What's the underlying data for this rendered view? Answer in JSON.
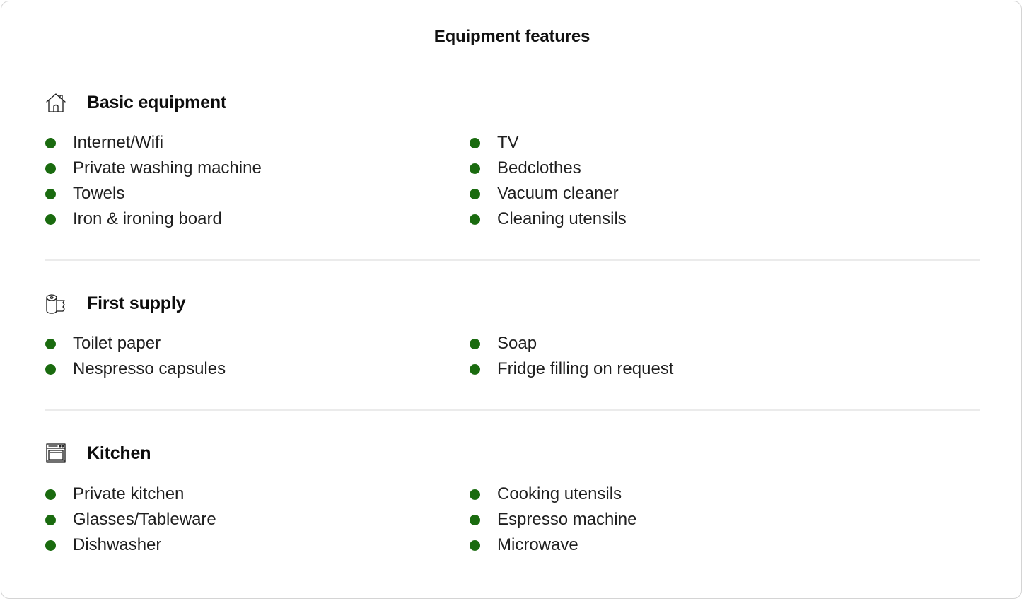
{
  "title": "Equipment features",
  "colors": {
    "bullet": "#1a6b0f",
    "divider": "#ebebeb",
    "border": "#d4d4d4"
  },
  "sections": [
    {
      "icon": "house-icon",
      "title": "Basic equipment",
      "left": [
        "Internet/Wifi",
        "Private washing machine",
        "Towels",
        "Iron & ironing board"
      ],
      "right": [
        "TV",
        "Bedclothes",
        "Vacuum cleaner",
        "Cleaning utensils"
      ]
    },
    {
      "icon": "toilet-paper-icon",
      "title": "First supply",
      "left": [
        "Toilet paper",
        "Nespresso capsules"
      ],
      "right": [
        "Soap",
        "Fridge filling on request"
      ]
    },
    {
      "icon": "oven-icon",
      "title": "Kitchen",
      "left": [
        "Private kitchen",
        "Glasses/Tableware",
        "Dishwasher"
      ],
      "right": [
        "Cooking utensils",
        "Espresso machine",
        "Microwave"
      ]
    }
  ]
}
